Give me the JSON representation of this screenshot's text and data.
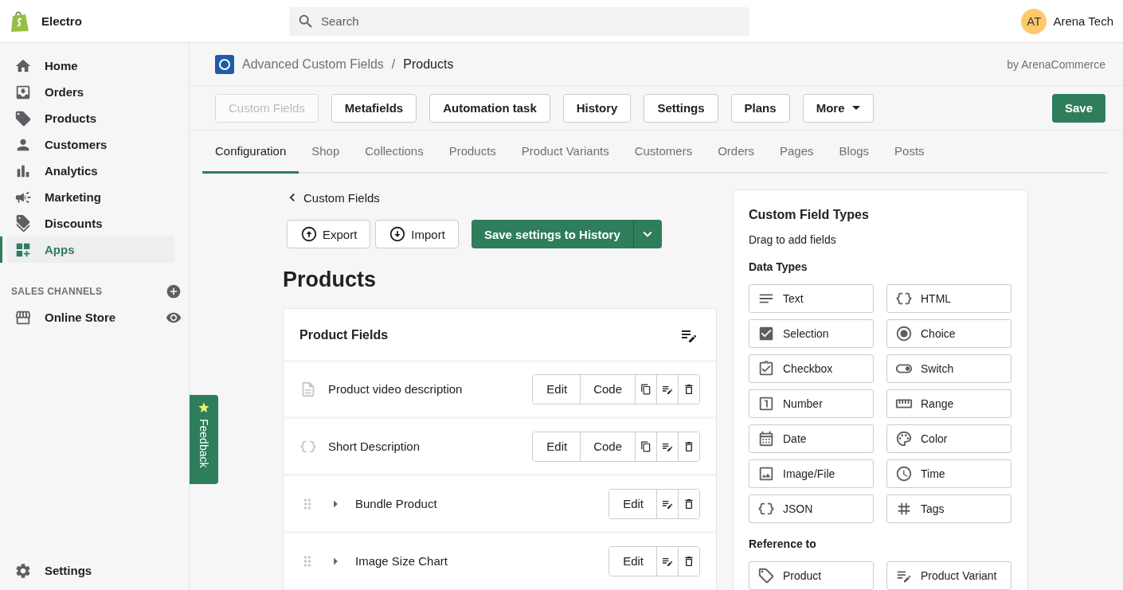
{
  "topbar": {
    "store": "Electro",
    "search": {
      "placeholder": "Search"
    },
    "user": {
      "initials": "AT",
      "name": "Arena Tech"
    }
  },
  "sidebar": {
    "items": [
      {
        "label": "Home",
        "kind": "home",
        "selected": false
      },
      {
        "label": "Orders",
        "kind": "orders",
        "selected": false
      },
      {
        "label": "Products",
        "kind": "products",
        "selected": false
      },
      {
        "label": "Customers",
        "kind": "customers",
        "selected": false
      },
      {
        "label": "Analytics",
        "kind": "analytics",
        "selected": false
      },
      {
        "label": "Marketing",
        "kind": "marketing",
        "selected": false
      },
      {
        "label": "Discounts",
        "kind": "discounts",
        "selected": false
      },
      {
        "label": "Apps",
        "kind": "apps",
        "selected": true
      }
    ],
    "section": "SALES CHANNELS",
    "channels": [
      {
        "label": "Online Store"
      }
    ],
    "settings": "Settings"
  },
  "app_header": {
    "app": "Advanced Custom Fields",
    "separator": "/",
    "page": "Products",
    "by": "by ArenaCommerce"
  },
  "toolbar": {
    "buttons": [
      {
        "label": "Custom Fields",
        "disabled": true
      },
      {
        "label": "Metafields",
        "disabled": false
      },
      {
        "label": "Automation task",
        "disabled": false
      },
      {
        "label": "History",
        "disabled": false
      },
      {
        "label": "Settings",
        "disabled": false
      },
      {
        "label": "Plans",
        "disabled": false
      },
      {
        "label": "More",
        "disabled": false,
        "menu": true
      }
    ],
    "save": "Save"
  },
  "tabs": [
    {
      "label": "Configuration",
      "selected": true
    },
    {
      "label": "Shop",
      "selected": false
    },
    {
      "label": "Collections",
      "selected": false
    },
    {
      "label": "Products",
      "selected": false
    },
    {
      "label": "Product Variants",
      "selected": false
    },
    {
      "label": "Customers",
      "selected": false
    },
    {
      "label": "Orders",
      "selected": false
    },
    {
      "label": "Pages",
      "selected": false
    },
    {
      "label": "Blogs",
      "selected": false
    },
    {
      "label": "Posts",
      "selected": false
    }
  ],
  "back": "Custom Fields",
  "export": "Export",
  "import": "Import",
  "save_history": "Save settings to History",
  "title": "Products",
  "fields_card": {
    "title": "Product Fields",
    "rows": [
      {
        "label": "Product video description",
        "kind": "text",
        "buttons": [
          "Edit",
          "Code"
        ]
      },
      {
        "label": "Short Description",
        "kind": "html",
        "buttons": [
          "Edit",
          "Code"
        ]
      },
      {
        "label": "Bundle Product",
        "kind": "group",
        "buttons": [
          "Edit"
        ]
      },
      {
        "label": "Image Size Chart",
        "kind": "group",
        "buttons": [
          "Edit"
        ]
      }
    ]
  },
  "types_card": {
    "title": "Custom Field Types",
    "hint": "Drag to add fields",
    "data_title": "Data Types",
    "data_types": [
      {
        "label": "Text",
        "kind": "text"
      },
      {
        "label": "HTML",
        "kind": "html"
      },
      {
        "label": "Selection",
        "kind": "selection"
      },
      {
        "label": "Choice",
        "kind": "choice"
      },
      {
        "label": "Checkbox",
        "kind": "checkbox"
      },
      {
        "label": "Switch",
        "kind": "switch"
      },
      {
        "label": "Number",
        "kind": "number"
      },
      {
        "label": "Range",
        "kind": "range"
      },
      {
        "label": "Date",
        "kind": "date"
      },
      {
        "label": "Color",
        "kind": "color"
      },
      {
        "label": "Image/File",
        "kind": "image"
      },
      {
        "label": "Time",
        "kind": "time"
      },
      {
        "label": "JSON",
        "kind": "json"
      },
      {
        "label": "Tags",
        "kind": "tags"
      }
    ],
    "ref_title": "Reference to",
    "ref_types": [
      {
        "label": "Product",
        "kind": "product"
      },
      {
        "label": "Product Variant",
        "kind": "variant"
      }
    ]
  },
  "feedback": "Feedback"
}
